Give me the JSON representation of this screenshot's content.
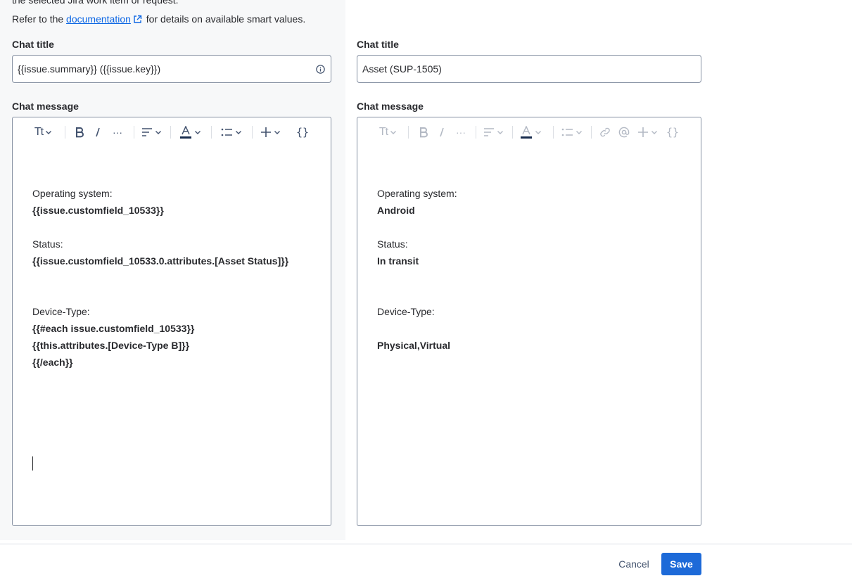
{
  "intro": {
    "line1": "the selected Jira work item or request.",
    "line2_prefix": "Refer to the ",
    "link_text": "documentation",
    "line2_suffix": " for details on available smart values."
  },
  "left": {
    "title_label": "Chat title",
    "title_value": "{{issue.summary}} ({{issue.key}})",
    "message_label": "Chat message",
    "lines": {
      "os_label": "Operating system:",
      "os_value": "{{issue.customfield_10533}}",
      "status_label": "Status:",
      "status_value": "{{issue.customfield_10533.0.attributes.[Asset Status]}}",
      "device_label": "Device-Type:",
      "each_start": "{{#each issue.customfield_10533}}",
      "each_attr": "{{this.attributes.[Device-Type B]}}",
      "each_end": "{{/each}}"
    }
  },
  "right": {
    "title_label": "Chat title",
    "title_value": "Asset (SUP-1505)",
    "message_label": "Chat message",
    "lines": {
      "os_label": "Operating system:",
      "os_value": "Android",
      "status_label": "Status:",
      "status_value": "In transit",
      "device_label": "Device-Type:",
      "device_value": "Physical,Virtual"
    }
  },
  "toolbar": {
    "text_style": "Tt",
    "more": "···",
    "code_braces": "{}"
  },
  "footer": {
    "cancel_label": "Cancel",
    "save_label": "Save"
  },
  "colors": {
    "primary": "#1d6ad8",
    "link": "#0c66e4",
    "text_color_underline": "#172b4d"
  }
}
